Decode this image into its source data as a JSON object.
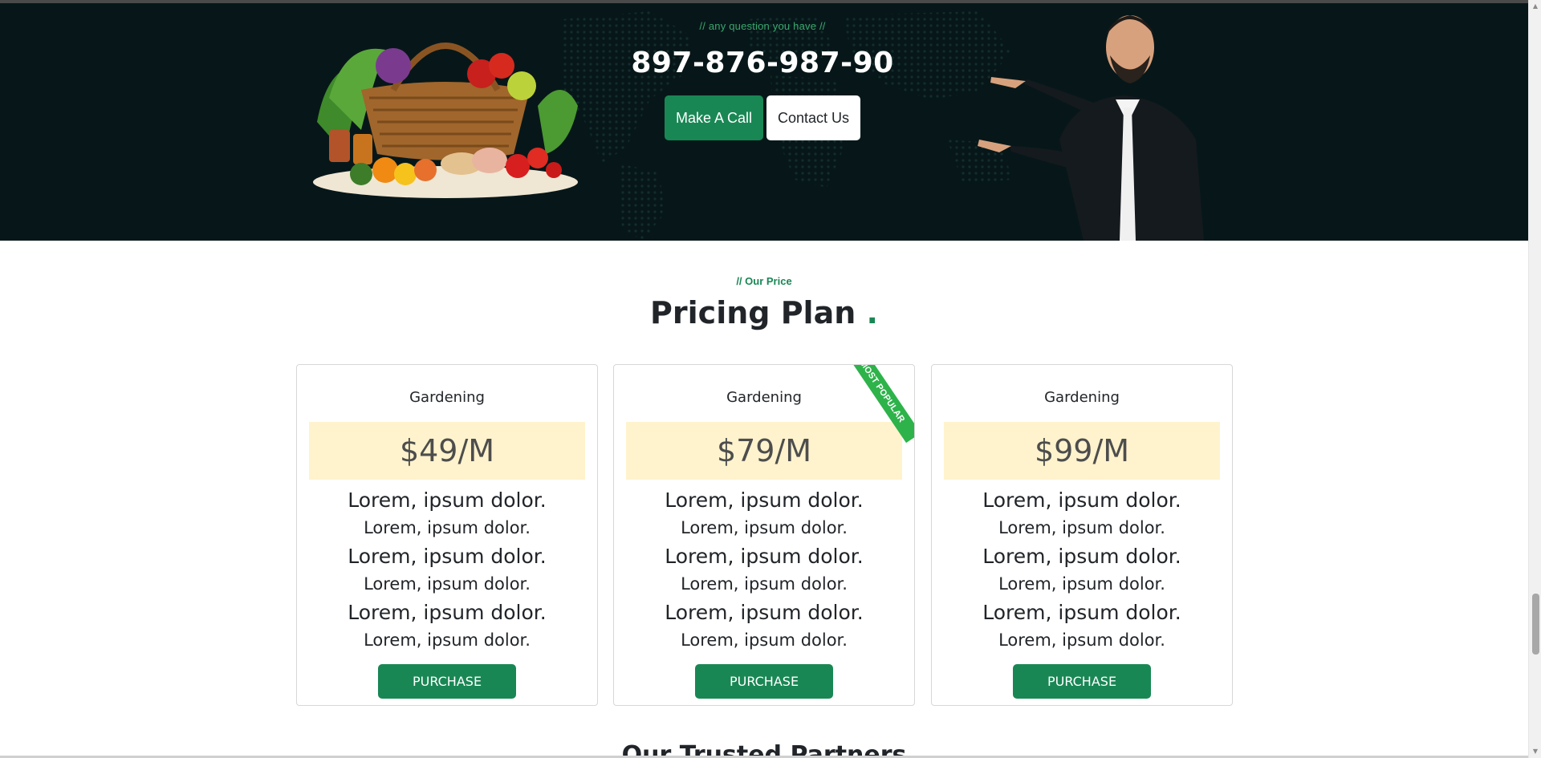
{
  "banner": {
    "eyebrow": "// any question you have //",
    "phone": "897-876-987-90",
    "call_button": "Make A Call",
    "contact_button": "Contact Us"
  },
  "pricing": {
    "eyebrow": "// Our Price",
    "title": "Pricing Plan",
    "title_dot": ".",
    "plans": [
      {
        "name": "Gardening",
        "price": "$49/M",
        "features": [
          "Lorem, ipsum dolor.",
          "Lorem, ipsum dolor.",
          "Lorem, ipsum dolor.",
          "Lorem, ipsum dolor.",
          "Lorem, ipsum dolor.",
          "Lorem, ipsum dolor."
        ],
        "button": "PURCHASE"
      },
      {
        "name": "Gardening",
        "price": "$79/M",
        "badge": "MOST POPULAR",
        "features": [
          "Lorem, ipsum dolor.",
          "Lorem, ipsum dolor.",
          "Lorem, ipsum dolor.",
          "Lorem, ipsum dolor.",
          "Lorem, ipsum dolor.",
          "Lorem, ipsum dolor."
        ],
        "button": "PURCHASE"
      },
      {
        "name": "Gardening",
        "price": "$99/M",
        "features": [
          "Lorem, ipsum dolor.",
          "Lorem, ipsum dolor.",
          "Lorem, ipsum dolor.",
          "Lorem, ipsum dolor.",
          "Lorem, ipsum dolor.",
          "Lorem, ipsum dolor."
        ],
        "button": "PURCHASE"
      }
    ]
  },
  "partners": {
    "title": "Our Trusted Partners"
  },
  "colors": {
    "brand_green": "#198754",
    "banner_bg": "#071719",
    "price_band": "#fff3cd",
    "ribbon": "#2db34a"
  },
  "icons": [
    "basket-image",
    "businessman-image",
    "world-dot-map"
  ]
}
